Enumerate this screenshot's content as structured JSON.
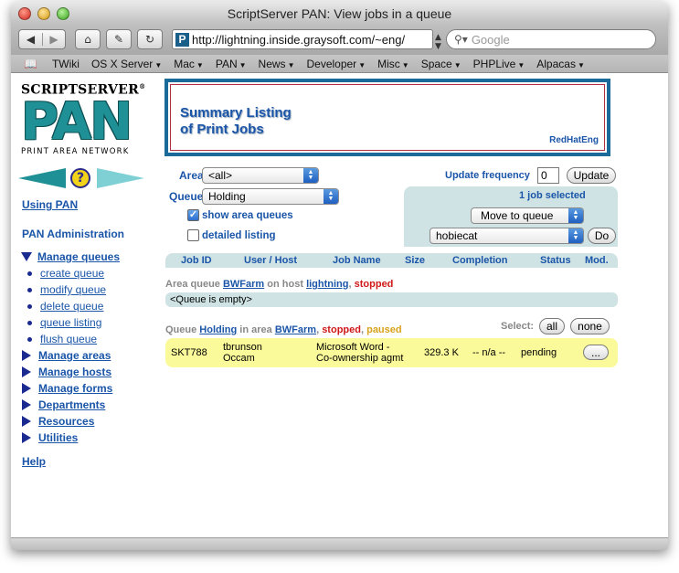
{
  "window": {
    "title": "ScriptServer PAN: View jobs in a queue"
  },
  "toolbar": {
    "back_glyph": "◀",
    "forward_glyph": "▶",
    "home_glyph": "⌂",
    "edit_glyph": "✎",
    "reload_glyph": "↻",
    "url": "http://lightning.inside.graysoft.com/~eng/",
    "favicon_letter": "P",
    "search_placeholder": "Google"
  },
  "bookmarks": [
    {
      "label": "TWiki",
      "menu": false
    },
    {
      "label": "OS X Server",
      "menu": true
    },
    {
      "label": "Mac",
      "menu": true
    },
    {
      "label": "PAN",
      "menu": true
    },
    {
      "label": "News",
      "menu": true
    },
    {
      "label": "Developer",
      "menu": true
    },
    {
      "label": "Misc",
      "menu": true
    },
    {
      "label": "Space",
      "menu": true
    },
    {
      "label": "PHPLive",
      "menu": true
    },
    {
      "label": "Alpacas",
      "menu": true
    }
  ],
  "logo": {
    "top": "SCRIPTSERVER",
    "reg": "®",
    "main": "PAN",
    "sub": "PRINT AREA NETWORK"
  },
  "nav": {
    "using_pan": "Using PAN",
    "pan_admin": "PAN Administration",
    "manage_queues": "Manage queues",
    "queue_items": [
      "create queue",
      "modify queue",
      "delete queue",
      "queue listing",
      "flush queue"
    ],
    "sections": [
      "Manage areas",
      "Manage hosts",
      "Manage forms",
      "Departments",
      "Resources",
      "Utilities"
    ],
    "help": "Help",
    "help_glyph": "?"
  },
  "summary": {
    "title_line1": "Summary Listing",
    "title_line2": "of Print Jobs",
    "host": "RedHatEng"
  },
  "filters": {
    "area_label": "Area",
    "area_value": "<all>",
    "queue_label": "Queue",
    "queue_value": "Holding",
    "show_area_queues": "show area queues",
    "show_area_queues_checked": true,
    "detailed_listing": "detailed listing",
    "detailed_listing_checked": false,
    "update_freq_label": "Update frequency",
    "update_freq_value": "0",
    "update_button": "Update"
  },
  "actions": {
    "selected_text": "1 job selected",
    "action_value": "Move to queue",
    "target_value": "hobiecat",
    "do_button": "Do"
  },
  "table": {
    "headers": [
      "Job ID",
      "User / Host",
      "Job Name",
      "Size",
      "Completion",
      "Status",
      "Mod."
    ]
  },
  "area_queue": {
    "prefix": "Area queue",
    "name": "BWFarm",
    "middle": "on host",
    "host": "lightning",
    "sep": ",",
    "state": "stopped",
    "empty_text": "<Queue is empty>"
  },
  "queue": {
    "prefix": "Queue",
    "name": "Holding",
    "middle": "in area",
    "area": "BWFarm",
    "sep": ",",
    "state1": "stopped",
    "state2": "paused",
    "select_label": "Select:",
    "all_button": "all",
    "none_button": "none"
  },
  "job": {
    "id": "SKT788",
    "user": "tbrunson",
    "host": "Occam",
    "name_line1": "Microsoft Word -",
    "name_line2": "Co-ownership agmt",
    "size": "329.3 K",
    "completion": "-- n/a --",
    "status": "pending",
    "mod_button": "..."
  }
}
